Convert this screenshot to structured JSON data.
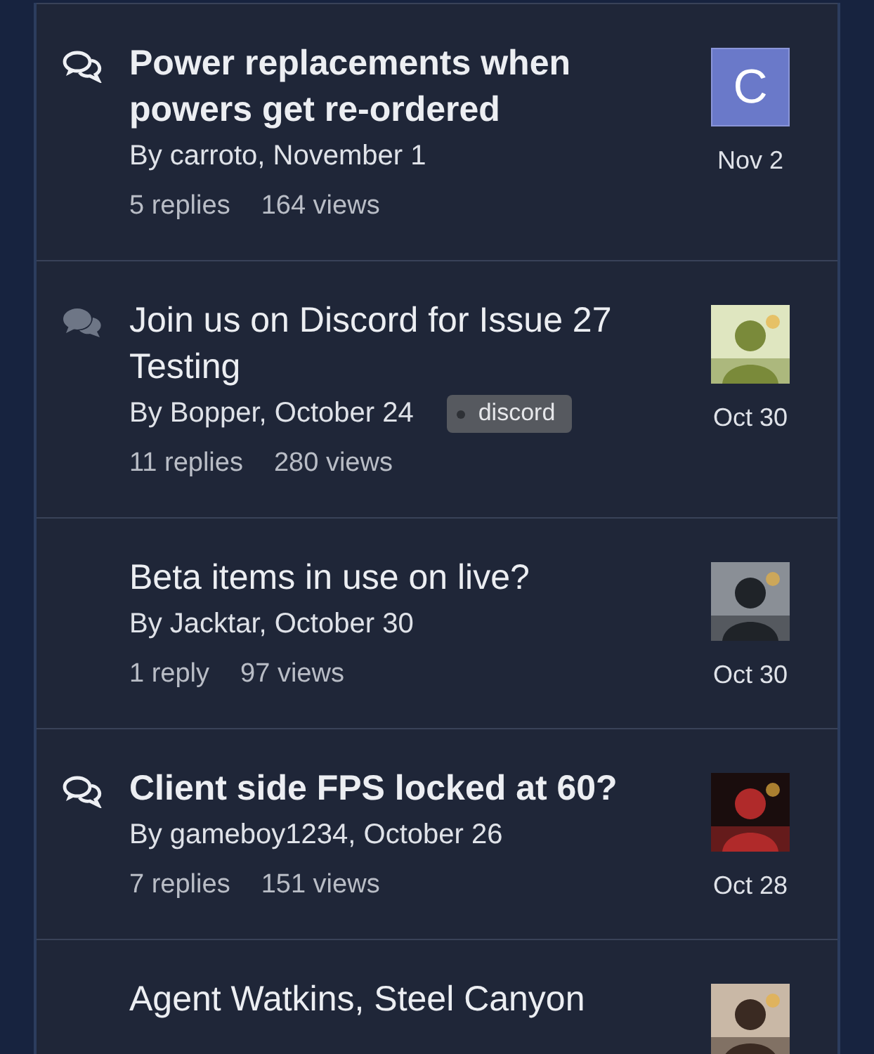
{
  "topics": [
    {
      "title": "Power replacements when powers get re-ordered",
      "unread": true,
      "posted": true,
      "byline": "By carroto, November 1",
      "replies": "5 replies",
      "views": "164 views",
      "avatar": {
        "kind": "letter",
        "letter": "C",
        "color": "#6a79c9"
      },
      "date": "Nov 2"
    },
    {
      "title": "Join us on Discord for Issue 27 Testing",
      "unread": false,
      "posted": true,
      "byline": "By Bopper, October 24",
      "tags": [
        "discord"
      ],
      "replies": "11 replies",
      "views": "280 views",
      "date": "Oct 30"
    },
    {
      "title": "Beta items in use on live?",
      "unread": false,
      "posted": false,
      "byline": "By Jacktar, October 30",
      "replies": "1 reply",
      "views": "97 views",
      "date": "Oct 30"
    },
    {
      "title": "Client side FPS locked at 60?",
      "unread": true,
      "posted": true,
      "byline": "By gameboy1234, October 26",
      "replies": "7 replies",
      "views": "151 views",
      "date": "Oct 28"
    },
    {
      "title": "Agent Watkins, Steel Canyon",
      "unread": false,
      "posted": false
    }
  ]
}
